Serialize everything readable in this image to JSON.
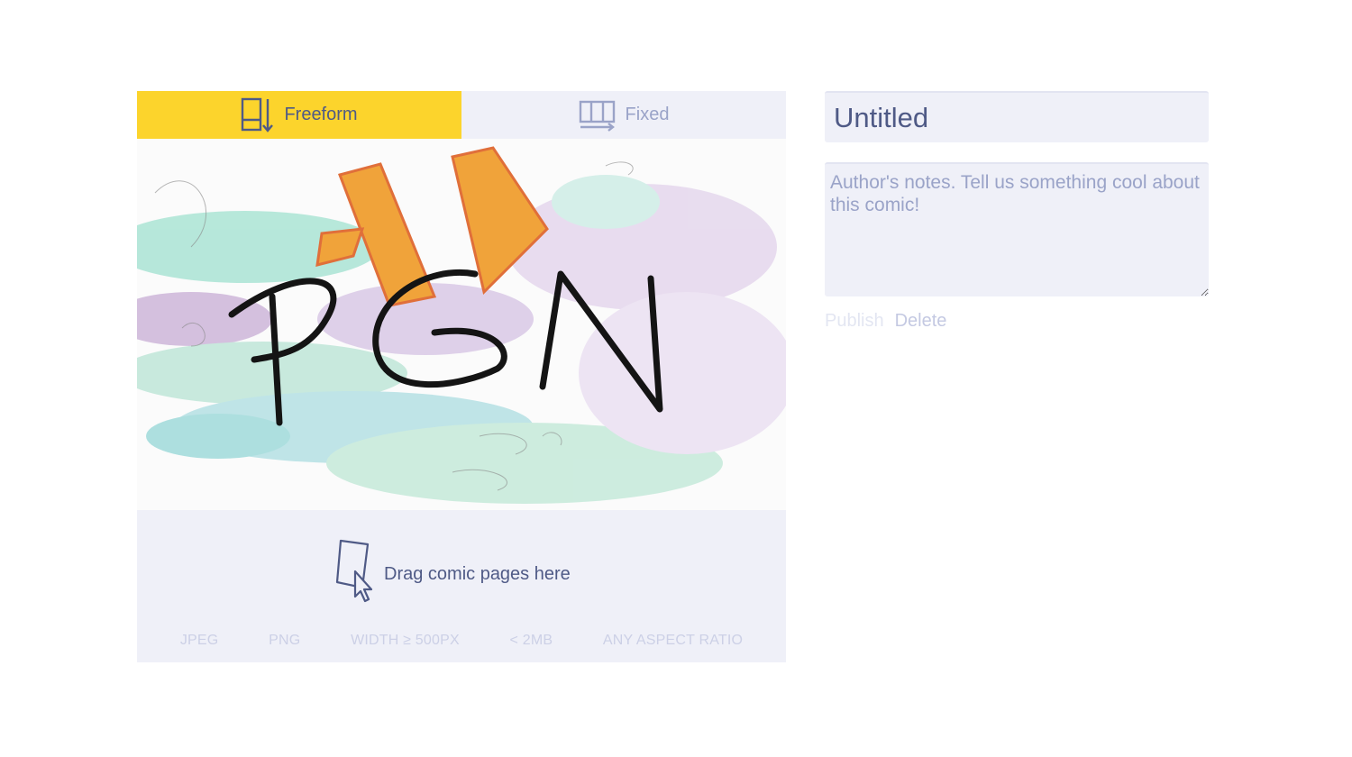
{
  "tabs": {
    "freeform": {
      "label": "Freeform",
      "icon": "freeform-layout-icon",
      "active": true
    },
    "fixed": {
      "label": "Fixed",
      "icon": "fixed-layout-icon",
      "active": false
    }
  },
  "canvas": {
    "artwork_text": "PGN"
  },
  "dropzone": {
    "message": "Drag comic pages here",
    "icon": "page-drag-cursor-icon",
    "requirements": [
      "JPEG",
      "PNG",
      "WIDTH ≥ 500PX",
      "< 2MB",
      "ANY ASPECT RATIO"
    ]
  },
  "form": {
    "title_value": "Untitled",
    "notes_placeholder": "Author's notes. Tell us something cool about this comic!",
    "publish_label": "Publish",
    "delete_label": "Delete"
  },
  "colors": {
    "accent_yellow": "#fcd42c",
    "panel_bg": "#eff0f8",
    "text_primary": "#4f5a86",
    "text_muted": "#9aa3c8"
  }
}
